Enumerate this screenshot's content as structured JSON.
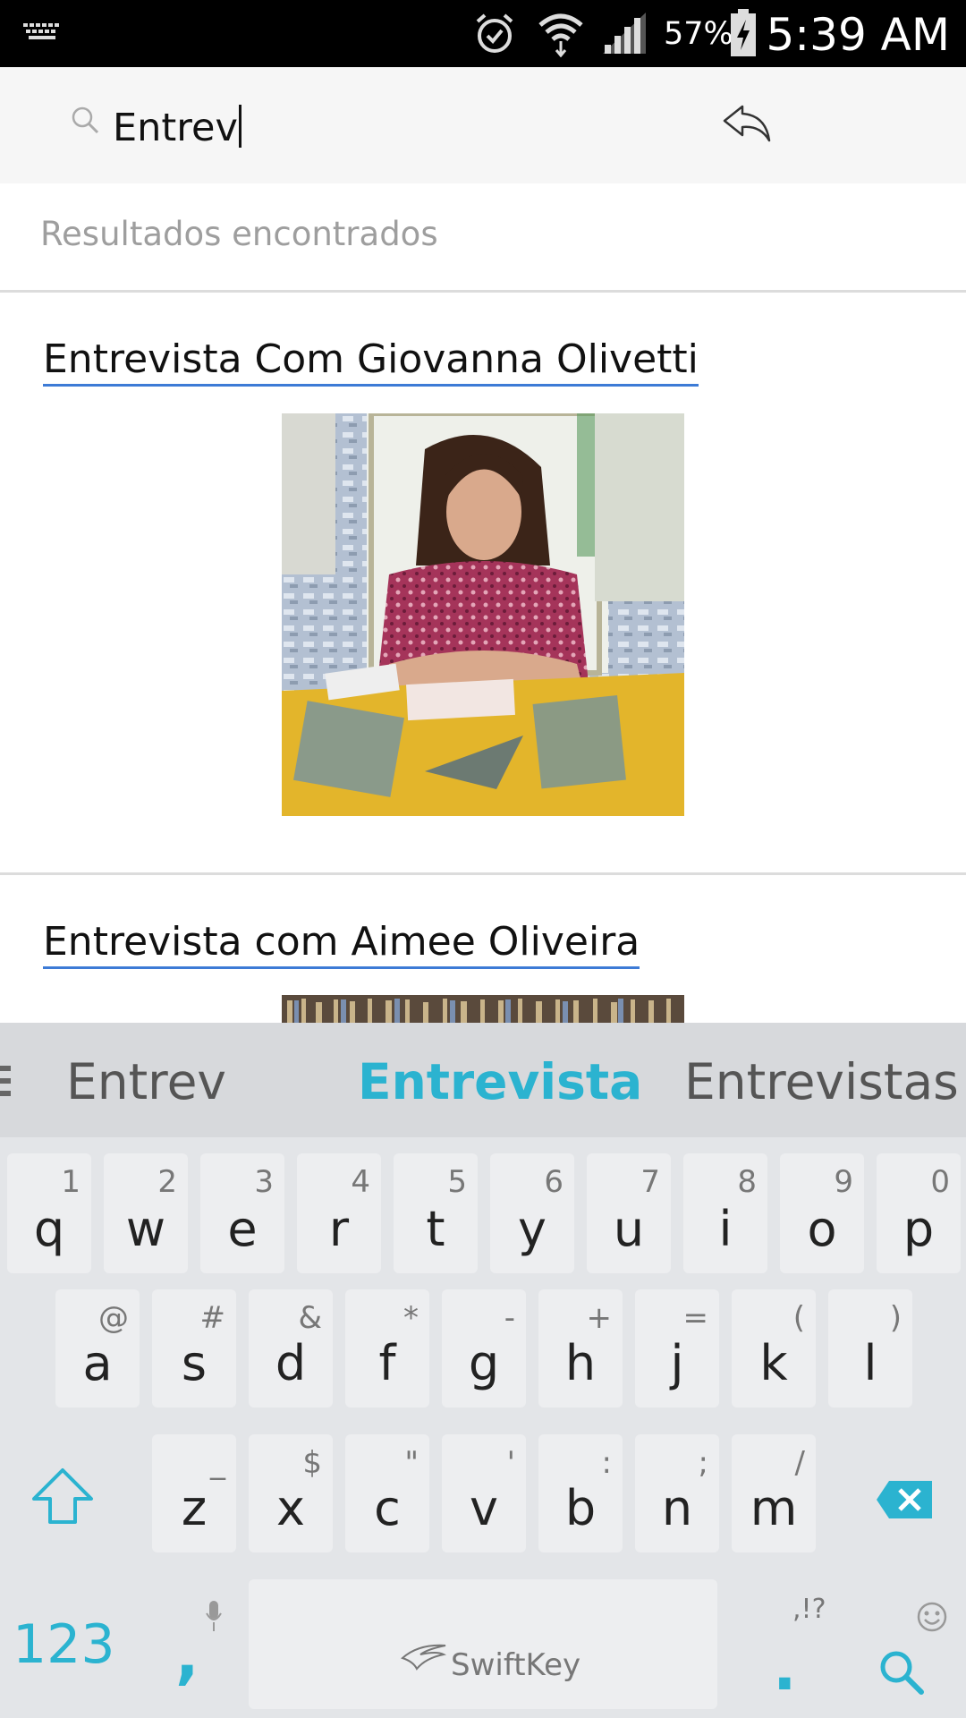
{
  "status_bar": {
    "battery": "57%",
    "time": "5:39 AM"
  },
  "search": {
    "value": "Entrev"
  },
  "results": {
    "label": "Resultados encontrados",
    "items": [
      {
        "title": "Entrevista Com Giovanna Olivetti"
      },
      {
        "title": "Entrevista com Aimee Oliveira"
      }
    ]
  },
  "keyboard": {
    "suggestions": [
      "Entrev",
      "Entrevista",
      "Entrevistas"
    ],
    "row1": [
      {
        "key": "q",
        "alt": "1"
      },
      {
        "key": "w",
        "alt": "2"
      },
      {
        "key": "e",
        "alt": "3"
      },
      {
        "key": "r",
        "alt": "4"
      },
      {
        "key": "t",
        "alt": "5"
      },
      {
        "key": "y",
        "alt": "6"
      },
      {
        "key": "u",
        "alt": "7"
      },
      {
        "key": "i",
        "alt": "8"
      },
      {
        "key": "o",
        "alt": "9"
      },
      {
        "key": "p",
        "alt": "0"
      }
    ],
    "row2": [
      {
        "key": "a",
        "alt": "@"
      },
      {
        "key": "s",
        "alt": "#"
      },
      {
        "key": "d",
        "alt": "&"
      },
      {
        "key": "f",
        "alt": "*"
      },
      {
        "key": "g",
        "alt": "-"
      },
      {
        "key": "h",
        "alt": "+"
      },
      {
        "key": "j",
        "alt": "="
      },
      {
        "key": "k",
        "alt": "("
      },
      {
        "key": "l",
        "alt": ")"
      }
    ],
    "row3": [
      {
        "key": "z",
        "alt": "_"
      },
      {
        "key": "x",
        "alt": "$"
      },
      {
        "key": "c",
        "alt": "\""
      },
      {
        "key": "v",
        "alt": "'"
      },
      {
        "key": "b",
        "alt": ":"
      },
      {
        "key": "n",
        "alt": ";"
      },
      {
        "key": "m",
        "alt": "/"
      }
    ],
    "num_label": "123",
    "comma": ",",
    "period": ".",
    "period_alt": ",!?",
    "space_brand": "SwiftKey",
    "accent": "#2bb3d0"
  }
}
